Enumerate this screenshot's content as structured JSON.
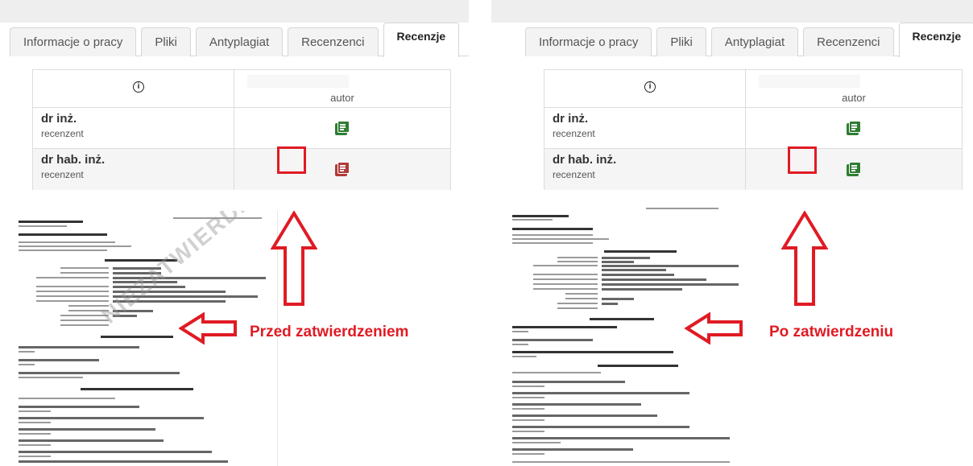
{
  "left": {
    "tabs": [
      {
        "label": "Informacje o pracy",
        "active": false
      },
      {
        "label": "Pliki",
        "active": false
      },
      {
        "label": "Antyplagiat",
        "active": false
      },
      {
        "label": "Recenzenci",
        "active": false
      },
      {
        "label": "Recenzje",
        "active": true
      }
    ],
    "table": {
      "info_icon": "info-icon",
      "column_header": "autor",
      "rows": [
        {
          "title": "dr inż.",
          "role": "recenzent",
          "icon_color": "#2e7d32"
        },
        {
          "title": "dr hab. inż.",
          "role": "recenzent",
          "icon_color": "#b03a3a"
        }
      ]
    },
    "caption": "Przed zatwierdzeniem",
    "watermark": "NIEZATWIERDZ",
    "doc_heading": "OCENA PRACY DYPLOMOWEJ"
  },
  "right": {
    "tabs": [
      {
        "label": "Informacje o pracy",
        "active": false
      },
      {
        "label": "Pliki",
        "active": false
      },
      {
        "label": "Antyplagiat",
        "active": false
      },
      {
        "label": "Recenzenci",
        "active": false
      },
      {
        "label": "Recenzje",
        "active": true
      }
    ],
    "table": {
      "info_icon": "info-icon",
      "column_header": "autor",
      "rows": [
        {
          "title": "dr inż.",
          "role": "recenzent",
          "icon_color": "#2e7d32"
        },
        {
          "title": "dr hab. inż.",
          "role": "recenzent",
          "icon_color": "#2e7d32"
        }
      ]
    },
    "caption": "Po zatwierdzeniu",
    "doc_heading": "OCENA PRACY DYPLOMOWEJ"
  },
  "colors": {
    "accent_red": "#e01b24",
    "icon_green": "#2e7d32",
    "icon_red": "#b03a3a"
  }
}
